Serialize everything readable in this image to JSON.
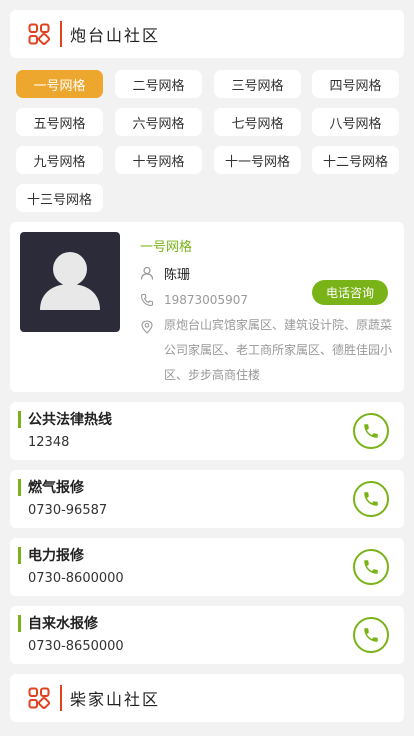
{
  "sections": [
    {
      "title": "炮台山社区",
      "icon": "grid-icon"
    },
    {
      "title": "柴家山社区",
      "icon": "grid-icon"
    }
  ],
  "grid_tabs": [
    {
      "label": "一号网格",
      "active": true
    },
    {
      "label": "二号网格"
    },
    {
      "label": "三号网格"
    },
    {
      "label": "四号网格"
    },
    {
      "label": "五号网格"
    },
    {
      "label": "六号网格"
    },
    {
      "label": "七号网格"
    },
    {
      "label": "八号网格"
    },
    {
      "label": "九号网格"
    },
    {
      "label": "十号网格"
    },
    {
      "label": "十一号网格"
    },
    {
      "label": "十二号网格"
    },
    {
      "label": "十三号网格"
    }
  ],
  "profile": {
    "grid_name": "一号网格",
    "person_name": "陈珊",
    "phone": "19873005907",
    "call_label": "电话咨询",
    "address": "原炮台山宾馆家属区、建筑设计院、原蔬菜公司家属区、老工商所家属区、德胜佳园小区、步步高商住楼"
  },
  "hotlines": [
    {
      "name": "公共法律热线",
      "number": "12348"
    },
    {
      "name": "燃气报修",
      "number": "0730-96587"
    },
    {
      "name": "电力报修",
      "number": "0730-8600000"
    },
    {
      "name": "自来水报修",
      "number": "0730-8650000"
    }
  ],
  "colors": {
    "accent_green": "#7ab317",
    "active_tab": "#eea72e",
    "header_red": "#e0411f"
  }
}
